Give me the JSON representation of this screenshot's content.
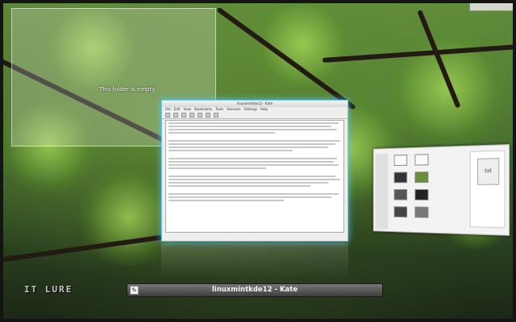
{
  "wallpaper": {
    "colors": {
      "foliage": "#7fb63b",
      "bark": "#231a14",
      "glow": "#7fc9e8"
    }
  },
  "folder_view": {
    "empty_text": "This folder is empty."
  },
  "top_right_widget": {
    "text": "",
    "icon": "x-icon"
  },
  "kate_window": {
    "title": "linuxmintkde12 - Kate",
    "menu": [
      "File",
      "Edit",
      "View",
      "Bookmarks",
      "Tools",
      "Sessions",
      "Settings",
      "Help"
    ],
    "status": ""
  },
  "dolphin_window": {
    "preview_label": "txt"
  },
  "logo": {
    "text": "IT LURE"
  },
  "taskbar": {
    "active_task_title": "linuxmintkde12 - Kate",
    "active_task_icon": "kate-icon"
  }
}
